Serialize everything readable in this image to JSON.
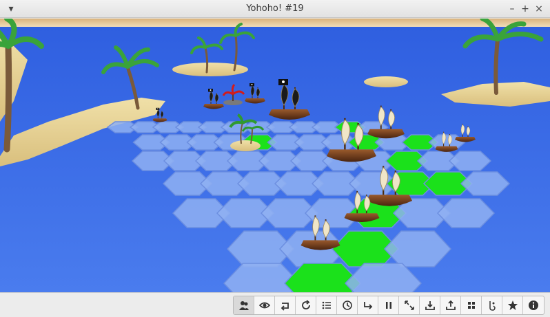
{
  "window": {
    "title": "Yohoho! #19"
  },
  "titlebar_icons": [
    "chevron-down-icon",
    "minimize-icon",
    "maximize-icon",
    "close-icon"
  ],
  "toolbar": {
    "buttons": [
      {
        "name": "players-button",
        "icon": "players-icon"
      },
      {
        "name": "view-button",
        "icon": "eye-icon"
      },
      {
        "name": "undo-button",
        "icon": "undo-icon"
      },
      {
        "name": "restart-button",
        "icon": "restart-icon"
      },
      {
        "name": "moves-list-button",
        "icon": "list-icon"
      },
      {
        "name": "clock-button",
        "icon": "clock-icon"
      },
      {
        "name": "redo-button",
        "icon": "redo-icon"
      },
      {
        "name": "pause-button",
        "icon": "pause-icon"
      },
      {
        "name": "fullscreen-button",
        "icon": "fullscreen-icon"
      },
      {
        "name": "download-button",
        "icon": "download-icon"
      },
      {
        "name": "upload-button",
        "icon": "upload-icon"
      },
      {
        "name": "grid-button",
        "icon": "grid-icon"
      },
      {
        "name": "hint-button",
        "icon": "hint-icon"
      },
      {
        "name": "favorite-button",
        "icon": "star-icon"
      },
      {
        "name": "info-button",
        "icon": "info-icon"
      }
    ]
  },
  "colors": {
    "sea": "#3b6ee6",
    "hex": "#8fb0f2",
    "highlight": "#1be11b",
    "sand": "#e9d59b",
    "sky": "#e4c79a"
  }
}
